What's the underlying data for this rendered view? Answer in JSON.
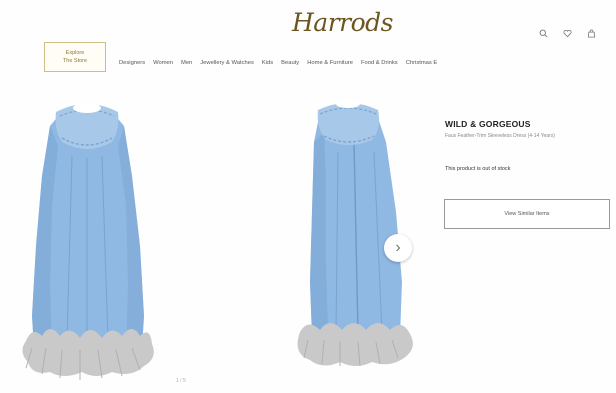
{
  "header": {
    "logo_text": "Harrods",
    "explore_line1": "Explore",
    "explore_line2": "The Store",
    "icons": [
      "search-icon",
      "heart-icon",
      "bag-icon"
    ]
  },
  "nav": {
    "items": [
      "Designers",
      "Women",
      "Men",
      "Jewellery & Watches",
      "Kids",
      "Beauty",
      "Home & Furniture",
      "Food & Drinks",
      "Christmas E"
    ]
  },
  "gallery": {
    "pager": "1 / 5",
    "next_symbol": "›"
  },
  "product": {
    "brand": "WILD & GORGEOUS",
    "name": "Faux Feather-Trim Sleeveless Dress (4-14 Years)",
    "stock_message": "This product is out of stock",
    "similar_button": "View Similar Items"
  },
  "colors": {
    "dress_blue": "#8fb8e2",
    "feather_grey": "#c9c9c9",
    "gold": "#6b5520"
  }
}
